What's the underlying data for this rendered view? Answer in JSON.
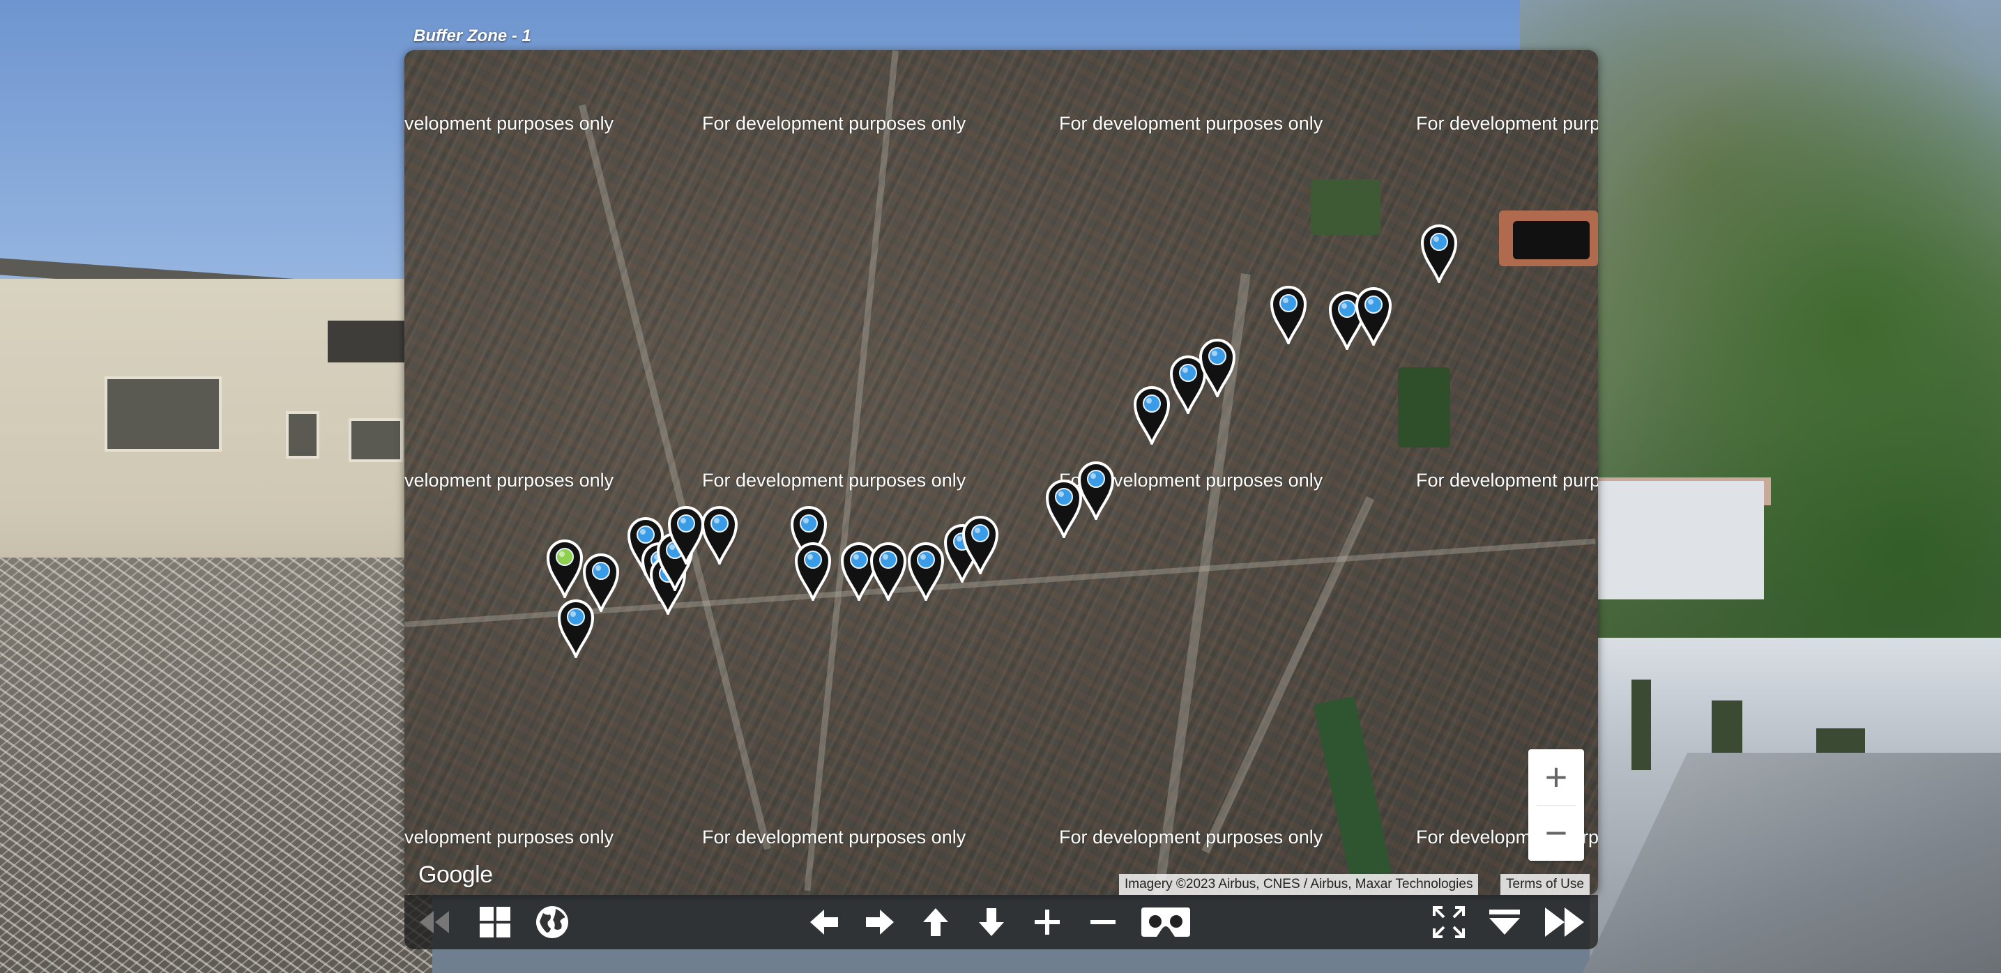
{
  "map": {
    "title": "Buffer Zone - 1",
    "watermark": "For development purposes only",
    "watermark_left": "velopment purposes only",
    "watermark_right": "For development purp",
    "watermark_right2": "For developm",
    "watermark_right2_end": "rp",
    "google_logo": "Google",
    "attribution": "Imagery ©2023 Airbus, CNES / Airbus, Maxar Technologies",
    "terms": "Terms of Use",
    "zoom_in": "+",
    "zoom_out": "−",
    "marker_color_active": "#8fd14f",
    "marker_color": "#3a9be6"
  },
  "toolbar": {
    "left": [
      "first-icon",
      "grid-icon",
      "globe-icon"
    ],
    "center": [
      "arrow-left-icon",
      "arrow-right-icon",
      "arrow-up-icon",
      "arrow-down-icon",
      "plus-icon",
      "minus-icon",
      "vr-headset-icon"
    ],
    "right": [
      "fullscreen-icon",
      "hide-controls-icon",
      "last-icon"
    ]
  }
}
